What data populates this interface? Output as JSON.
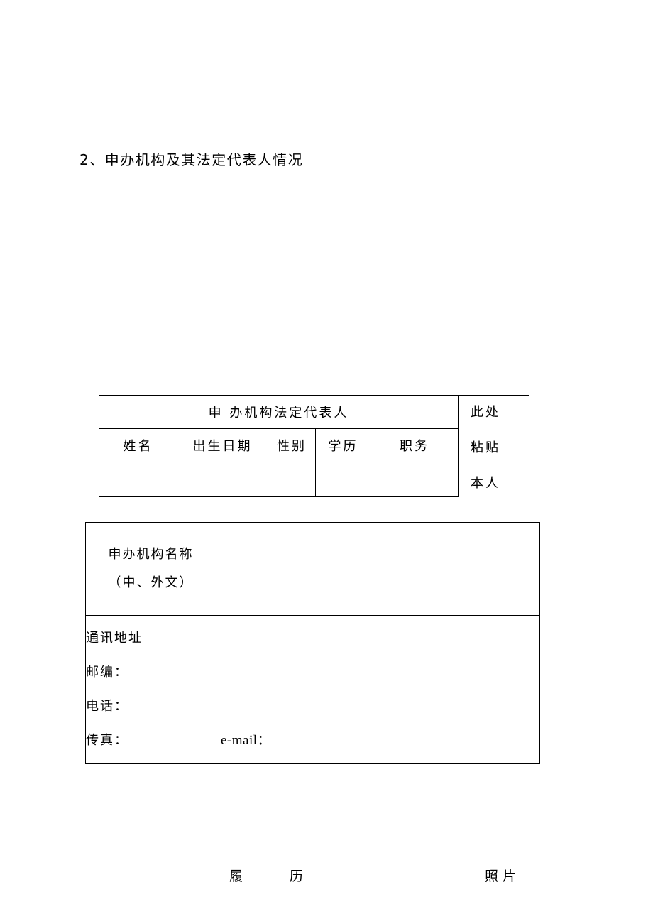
{
  "document": {
    "heading": "2、申办机构及其法定代表人情况",
    "representative_table": {
      "title": "申  办机构法定代表人",
      "headers": [
        "姓名",
        "出生日期",
        "性别",
        "学历",
        "职务"
      ],
      "values": [
        "",
        "",
        "",
        "",
        ""
      ]
    },
    "photo_note": {
      "line1": "此处",
      "line2": "粘贴",
      "line3": "本人"
    },
    "organization_table": {
      "name_label_line1": "申办机构名称",
      "name_label_line2": "（中、外文）",
      "name_value": "",
      "address_label": "通讯地址",
      "postcode_label": "邮编：",
      "phone_label": "电话：",
      "fax_label": "传真：",
      "email_label": "e-mail："
    },
    "footer": {
      "resume": "履    历",
      "photo": "照片"
    }
  }
}
